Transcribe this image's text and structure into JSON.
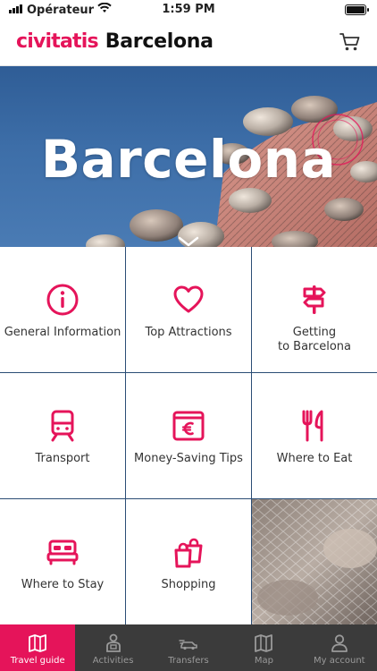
{
  "status_bar": {
    "carrier": "Opérateur",
    "time": "1:59 PM"
  },
  "header": {
    "logo": "civitatis",
    "city": "Barcelona"
  },
  "hero": {
    "title": "Barcelona"
  },
  "grid": {
    "tiles": [
      {
        "label": "General Information",
        "icon": "info-icon"
      },
      {
        "label": "Top Attractions",
        "icon": "heart-icon"
      },
      {
        "label": "Getting\nto Barcelona",
        "icon": "signpost-icon"
      },
      {
        "label": "Transport",
        "icon": "train-icon"
      },
      {
        "label": "Money-Saving Tips",
        "icon": "euro-wallet-icon"
      },
      {
        "label": "Where to Eat",
        "icon": "fork-knife-icon"
      },
      {
        "label": "Where to Stay",
        "icon": "bed-icon"
      },
      {
        "label": "Shopping",
        "icon": "shopping-bags-icon"
      }
    ]
  },
  "tab_bar": {
    "items": [
      {
        "label": "Travel guide",
        "icon": "map-book-icon",
        "active": true
      },
      {
        "label": "Activities",
        "icon": "tour-guide-icon",
        "active": false
      },
      {
        "label": "Transfers",
        "icon": "transfer-car-icon",
        "active": false
      },
      {
        "label": "Map",
        "icon": "map-icon",
        "active": false
      },
      {
        "label": "My account",
        "icon": "user-icon",
        "active": false
      }
    ]
  },
  "colors": {
    "brand": "#e5145a",
    "tab_bar_bg": "#3b3b3b",
    "tab_inactive": "#9a9a9a",
    "hero_sky": "#3d6ea8",
    "grid_border": "#2b4d75"
  }
}
